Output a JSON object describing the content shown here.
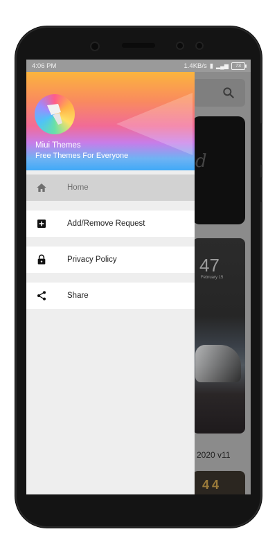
{
  "status_bar": {
    "time": "4:06 PM",
    "net_speed": "1.4KB/s",
    "battery": "73"
  },
  "drawer": {
    "app_title": "Miui Themes",
    "app_subtitle": "Free Themes For Everyone",
    "items": [
      {
        "label": "Home",
        "icon": "home-icon",
        "selected": true
      },
      {
        "label": "Add/Remove Request",
        "icon": "plus-box-icon",
        "selected": false
      },
      {
        "label": "Privacy Policy",
        "icon": "lock-icon",
        "selected": false
      },
      {
        "label": "Share",
        "icon": "share-icon",
        "selected": false
      }
    ]
  },
  "background": {
    "card_clock": "47",
    "card_date": "February 15",
    "card_caption": "2020 v11",
    "card3_digits": "44"
  },
  "colors": {
    "selected_row": "#d2d2d2",
    "header_gradient_top": "#fbb53d",
    "header_gradient_bottom": "#40a9f7"
  }
}
